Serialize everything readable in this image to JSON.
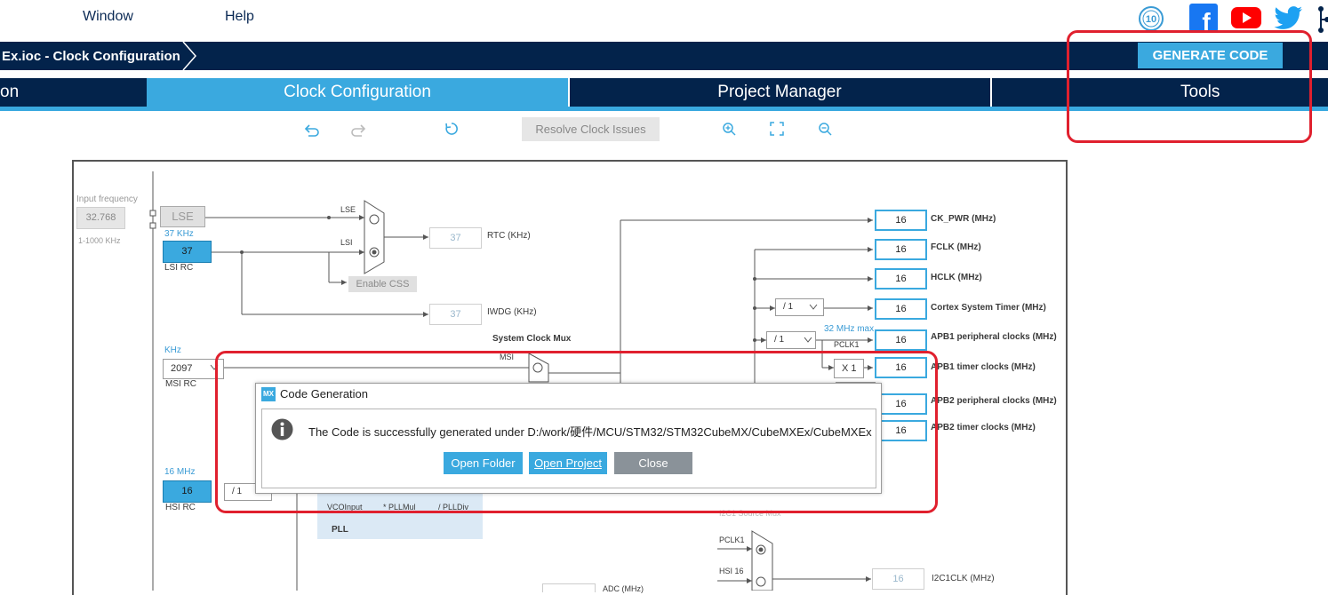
{
  "menu": {
    "window": "Window",
    "help": "Help"
  },
  "breadcrumb": "Ex.ioc - Clock Configuration",
  "generate_button": "GENERATE CODE",
  "tabs": [
    "on",
    "Clock Configuration",
    "Project Manager",
    "Tools"
  ],
  "toolbar": {
    "resolve": "Resolve Clock Issues"
  },
  "social_icons": [
    "st-10-years-icon",
    "facebook-icon",
    "youtube-icon",
    "twitter-icon",
    "network-icon"
  ],
  "diagram": {
    "input_frequency_label": "Input frequency",
    "input_frequency_value": "32.768",
    "input_range": "1-1000 KHz",
    "lse": "LSE",
    "lsi_freq": "37 KHz",
    "lsi_value": "37",
    "lsi_rc": "LSI RC",
    "mux_lse": "LSE",
    "mux_lsi": "LSI",
    "enable_css": "Enable CSS",
    "rtc_value": "37",
    "rtc_label": "RTC (KHz)",
    "iwdg_value": "37",
    "iwdg_label": "IWDG (KHz)",
    "msi_unit": "KHz",
    "msi_value": "2097",
    "msi_rc": "MSI RC",
    "sysclk_mux": "System Clock Mux",
    "msi": "MSI",
    "hsi_freq": "16 MHz",
    "hsi_value": "16",
    "hsi_rc": "HSI RC",
    "hsi_div": "/ 1",
    "vco_input": "VCOInput",
    "pll_mul": "* PLLMul",
    "pll_div": "/ PLLDiv",
    "pll": "PLL",
    "i2c_source_mux": "I2C1 Source Mux",
    "pclk1_in": "PCLK1",
    "hsi16_in": "HSI 16",
    "i2c_value": "16",
    "i2c_label": "I2C1CLK (MHz)",
    "adc_label": "ADC (MHz)",
    "ahb_div": "/ 1",
    "apb1_div": "/ 1",
    "apb1_max": "32 MHz max",
    "pclk1": "PCLK1",
    "x1": "X 1",
    "outputs": [
      {
        "value": "16",
        "label": "CK_PWR (MHz)"
      },
      {
        "value": "16",
        "label": "FCLK (MHz)"
      },
      {
        "value": "16",
        "label": "HCLK (MHz)"
      },
      {
        "value": "16",
        "label": "Cortex System Timer (MHz)"
      },
      {
        "value": "16",
        "label": "APB1 peripheral clocks (MHz)"
      },
      {
        "value": "16",
        "label": "APB1 timer clocks (MHz)"
      },
      {
        "value": "16",
        "label": "APB2 peripheral clocks (MHz)"
      },
      {
        "value": "16",
        "label": "APB2 timer clocks (MHz)"
      }
    ]
  },
  "dialog": {
    "badge": "MX",
    "title": "Code Generation",
    "message": "The Code is successfully generated under D:/work/硬件/MCU/STM32/STM32CubeMX/CubeMXEx/CubeMXEx",
    "open_folder": "Open Folder",
    "open_project": "Open Project",
    "close": "Close"
  },
  "colors": {
    "navy": "#03234b",
    "accent": "#3aa9df",
    "highlight": "#e0202e"
  }
}
